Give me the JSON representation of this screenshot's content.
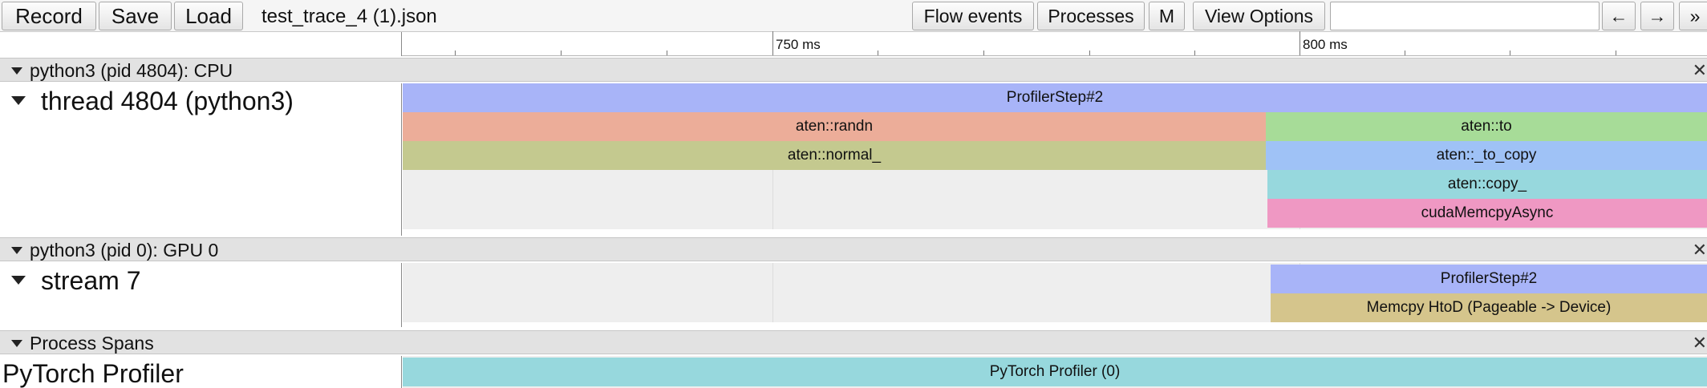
{
  "toolbar": {
    "record_label": "Record",
    "save_label": "Save",
    "load_label": "Load",
    "filename": "test_trace_4 (1).json",
    "flow_events_label": "Flow events",
    "processes_label": "Processes",
    "m_label": "M",
    "view_options_label": "View Options",
    "prev_label": "←",
    "next_label": "→",
    "more_label": "»"
  },
  "ruler": {
    "major_ticks": [
      "750 ms",
      "800 ms"
    ]
  },
  "processes": [
    {
      "header": "python3 (pid 4804): CPU",
      "thread": "thread 4804 (python3)",
      "slices": [
        {
          "name": "ProfilerStep#2",
          "color": "#a8b4f8"
        },
        {
          "name": "aten::randn",
          "color": "#ecad99"
        },
        {
          "name": "aten::to",
          "color": "#a7dc98"
        },
        {
          "name": "aten::normal_",
          "color": "#c4c98f"
        },
        {
          "name": "aten::_to_copy",
          "color": "#9fc2f6"
        },
        {
          "name": "aten::copy_",
          "color": "#97d8dd"
        },
        {
          "name": "cudaMemcpyAsync",
          "color": "#ef98c3"
        }
      ]
    },
    {
      "header": "python3 (pid 0): GPU 0",
      "thread": "stream 7",
      "slices": [
        {
          "name": "ProfilerStep#2",
          "color": "#a8b4f8"
        },
        {
          "name": "Memcpy HtoD (Pageable -> Device)",
          "color": "#d5c58c"
        }
      ]
    },
    {
      "header": "Process Spans",
      "thread": "PyTorch Profiler",
      "slices": [
        {
          "name": "PyTorch Profiler (0)",
          "color": "#97d8dd"
        }
      ]
    }
  ]
}
